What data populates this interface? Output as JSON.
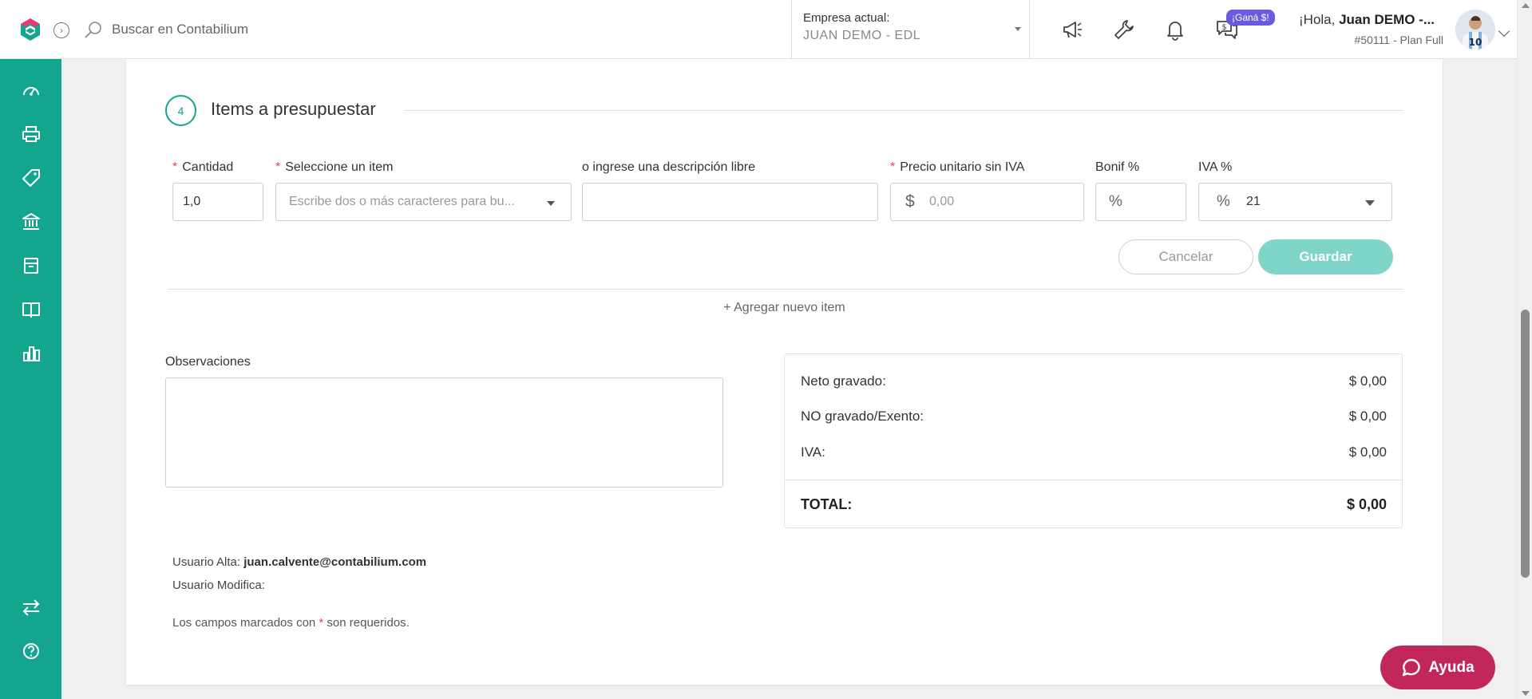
{
  "header": {
    "search_placeholder": "Buscar en Contabilium",
    "company_label": "Empresa actual:",
    "company_value": "JUAN DEMO - EDL",
    "promo_badge": "¡Ganá $!",
    "greeting_prefix": "¡Hola, ",
    "user_name": "Juan DEMO -...",
    "plan": "#50111 - Plan Full",
    "accent_color": "#13a58e"
  },
  "sidebar": {
    "icons": [
      "dashboard-icon",
      "printer-icon",
      "tag-icon",
      "bank-icon",
      "archive-icon",
      "book-icon",
      "chart-icon",
      "transfer-icon",
      "help-circle-icon"
    ]
  },
  "section": {
    "step_number": "4",
    "title": "Items a presupuestar"
  },
  "item_form": {
    "quantity_label": "Cantidad",
    "quantity_value": "1,0",
    "item_select_label": "Seleccione un item",
    "item_select_placeholder": "Escribe dos o más caracteres para bu...",
    "description_label": "o ingrese una descripción libre",
    "description_value": "",
    "price_label": "Precio unitario sin IVA",
    "price_symbol": "$",
    "price_placeholder": "0,00",
    "discount_label": "Bonif %",
    "discount_symbol": "%",
    "iva_label": "IVA %",
    "iva_symbol": "%",
    "iva_value": "21",
    "required_mark": "*",
    "cancel_label": "Cancelar",
    "save_label": "Guardar"
  },
  "add_item_label": "+ Agregar nuevo item",
  "observations_label": "Observaciones",
  "totals": {
    "neto_label": "Neto gravado:",
    "neto_value": "$ 0,00",
    "no_gravado_label": "NO gravado/Exento:",
    "no_gravado_value": "$ 0,00",
    "iva_label": "IVA:",
    "iva_value": "$ 0,00",
    "total_label": "TOTAL:",
    "total_value": "$ 0,00"
  },
  "meta": {
    "alta_label": "Usuario Alta: ",
    "alta_value": "juan.calvente@contabilium.com",
    "modifica_label": "Usuario Modifica:",
    "required_note_prefix": "Los campos marcados con ",
    "required_note_star": "*",
    "required_note_suffix": " son requeridos."
  },
  "help_button_label": "Ayuda"
}
